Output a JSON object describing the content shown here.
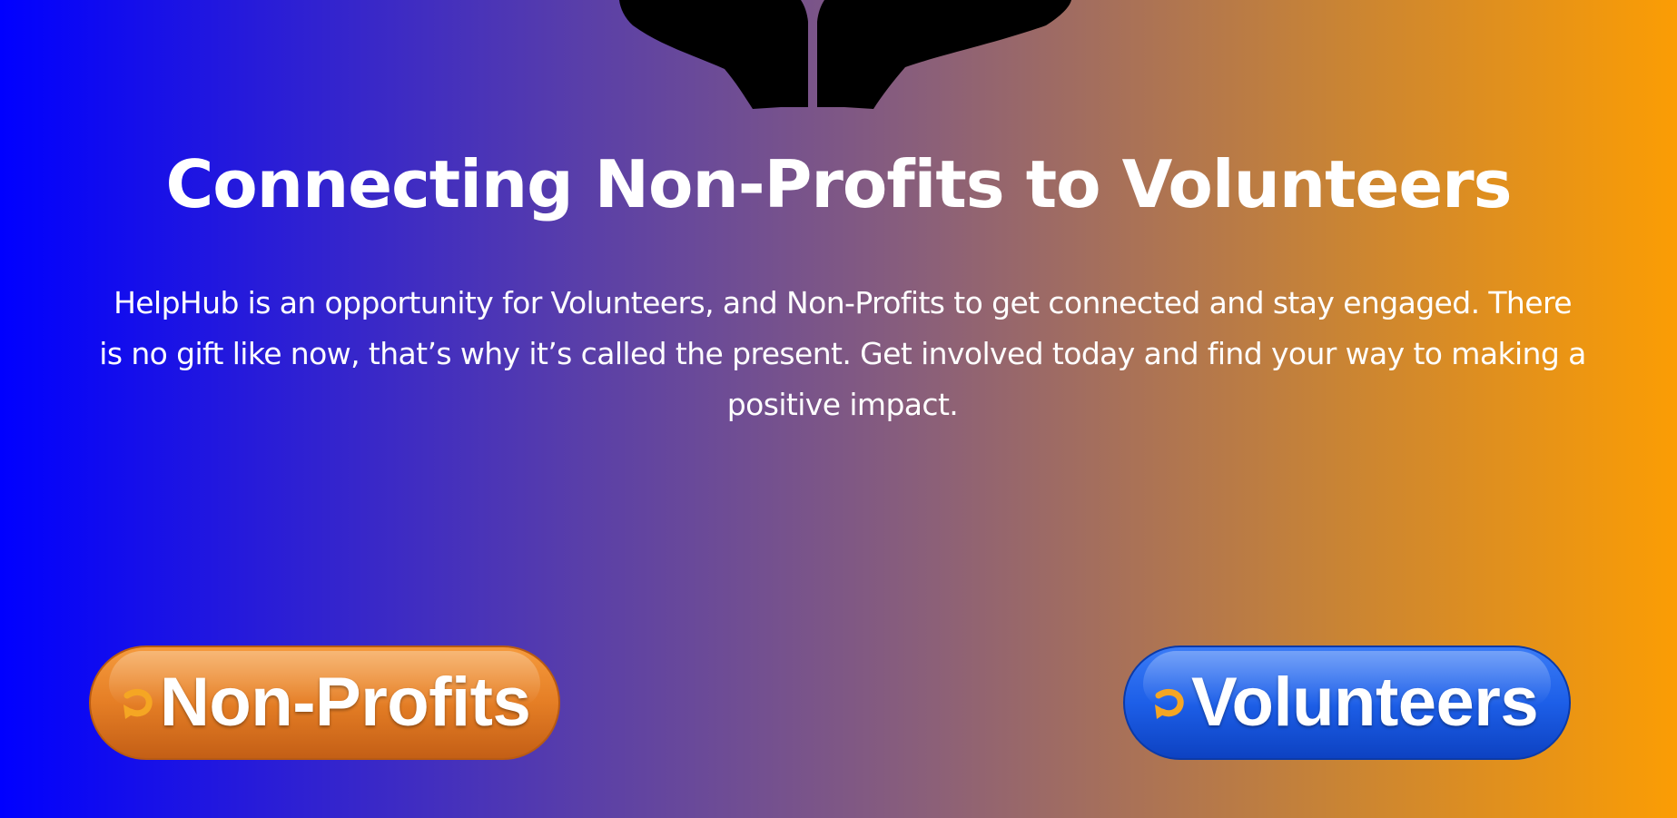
{
  "hero": {
    "title": "Connecting Non-Profits to Volunteers",
    "description": "HelpHub is an opportunity for Volunteers, and Non-Profits to get connected and stay engaged. There is no gift like now, that’s why it’s called the present. Get involved today and find your way to making a positive impact."
  },
  "logo": {
    "icon": "hands-logo-icon"
  },
  "cta": {
    "nonprofits_label": "Non-Profits",
    "volunteers_label": "Volunteers",
    "icon": "curved-arrow-icon"
  },
  "colors": {
    "gradient_start": "#0000ff",
    "gradient_end": "#fb9d04",
    "nonprofits_button": "#e57e25",
    "volunteers_button": "#1d5fe8",
    "arrow_icon": "#f5a623",
    "text": "#ffffff"
  }
}
